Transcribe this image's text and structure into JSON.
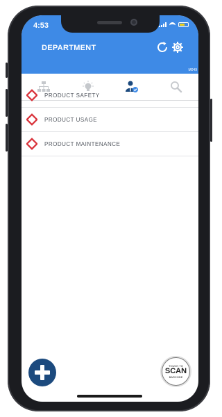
{
  "status_bar": {
    "time": "4:53"
  },
  "header": {
    "title": "DEPARTMENT",
    "code": "M049",
    "refresh_icon": "refresh-settings-icon",
    "settings_icon": "gear-icon"
  },
  "tabs": [
    {
      "icon": "hierarchy-icon",
      "active": false
    },
    {
      "icon": "lightbulb-icon",
      "active": false
    },
    {
      "icon": "user-check-icon",
      "active": true
    },
    {
      "icon": "search-icon",
      "active": false
    }
  ],
  "list": {
    "items": [
      {
        "label": "PRODUCT SAFETY"
      },
      {
        "label": "PRODUCT USAGE"
      },
      {
        "label": "PRODUCT MAINTENANCE"
      }
    ]
  },
  "fab": {
    "icon": "plus-icon"
  },
  "scan_button": {
    "small_top": "TOUCH TO",
    "big": "SCAN",
    "small_bottom": "BARCODE"
  },
  "colors": {
    "header": "#3e8ae6",
    "accent_dark": "#1c4a7e",
    "diamond": "#d9323a",
    "tab_inactive": "#c5c8cc"
  }
}
